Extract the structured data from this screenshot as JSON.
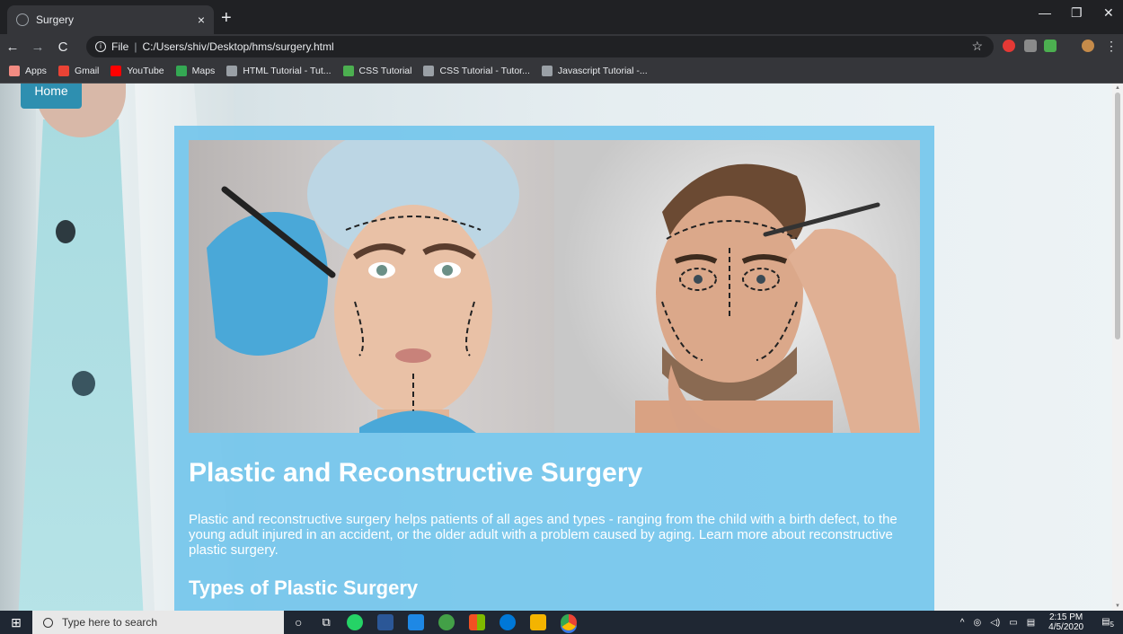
{
  "browser": {
    "tab_title": "Surgery",
    "tab_close": "×",
    "new_tab": "+",
    "minimize": "—",
    "maximize": "❐",
    "close": "✕",
    "back": "←",
    "forward": "→",
    "reload": "C",
    "address_prefix": "File",
    "address_url": "C:/Users/shiv/Desktop/hms/surgery.html",
    "bookmarks": [
      {
        "label": "Apps",
        "color": "#f28b82"
      },
      {
        "label": "Gmail",
        "color": "#ea4335"
      },
      {
        "label": "YouTube",
        "color": "#ff0000"
      },
      {
        "label": "Maps",
        "color": "#34a853"
      },
      {
        "label": "HTML Tutorial - Tut...",
        "color": "#9aa0a6"
      },
      {
        "label": "CSS Tutorial",
        "color": "#4caf50"
      },
      {
        "label": "CSS Tutorial - Tutor...",
        "color": "#9aa0a6"
      },
      {
        "label": "Javascript Tutorial -...",
        "color": "#9aa0a6"
      }
    ]
  },
  "page": {
    "home_link": "Home",
    "title": "Plastic and Reconstructive Surgery",
    "intro": "Plastic and reconstructive surgery helps patients of all ages and types - ranging from the child with a birth defect, to the young adult injured in an accident, or the older adult with a problem caused by aging. Learn more about reconstructive plastic surgery.",
    "subheading": "Types of Plastic Surgery",
    "card_color": "#6ec4ec"
  },
  "taskbar": {
    "search_placeholder": "Type here to search",
    "time": "2:15 PM",
    "date": "4/5/2020",
    "notification_count": "5"
  }
}
